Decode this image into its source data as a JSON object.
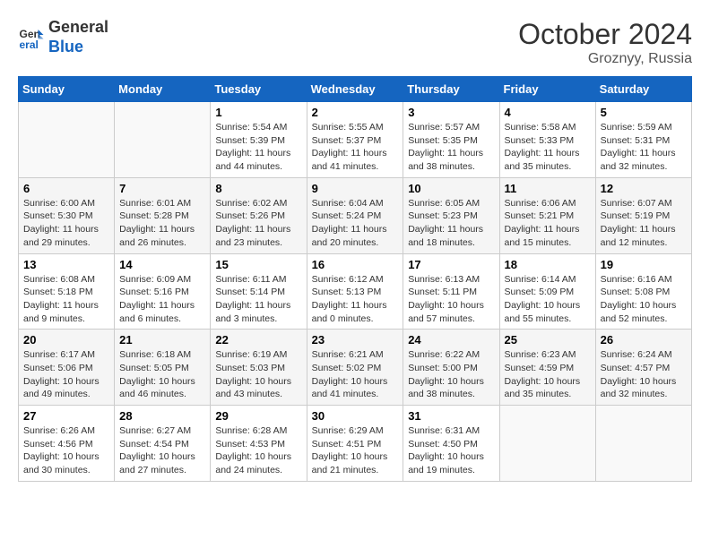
{
  "header": {
    "logo_line1": "General",
    "logo_line2": "Blue",
    "month": "October 2024",
    "location": "Groznyy, Russia"
  },
  "weekdays": [
    "Sunday",
    "Monday",
    "Tuesday",
    "Wednesday",
    "Thursday",
    "Friday",
    "Saturday"
  ],
  "weeks": [
    [
      {
        "day": "",
        "sunrise": "",
        "sunset": "",
        "daylight": ""
      },
      {
        "day": "",
        "sunrise": "",
        "sunset": "",
        "daylight": ""
      },
      {
        "day": "1",
        "sunrise": "Sunrise: 5:54 AM",
        "sunset": "Sunset: 5:39 PM",
        "daylight": "Daylight: 11 hours and 44 minutes."
      },
      {
        "day": "2",
        "sunrise": "Sunrise: 5:55 AM",
        "sunset": "Sunset: 5:37 PM",
        "daylight": "Daylight: 11 hours and 41 minutes."
      },
      {
        "day": "3",
        "sunrise": "Sunrise: 5:57 AM",
        "sunset": "Sunset: 5:35 PM",
        "daylight": "Daylight: 11 hours and 38 minutes."
      },
      {
        "day": "4",
        "sunrise": "Sunrise: 5:58 AM",
        "sunset": "Sunset: 5:33 PM",
        "daylight": "Daylight: 11 hours and 35 minutes."
      },
      {
        "day": "5",
        "sunrise": "Sunrise: 5:59 AM",
        "sunset": "Sunset: 5:31 PM",
        "daylight": "Daylight: 11 hours and 32 minutes."
      }
    ],
    [
      {
        "day": "6",
        "sunrise": "Sunrise: 6:00 AM",
        "sunset": "Sunset: 5:30 PM",
        "daylight": "Daylight: 11 hours and 29 minutes."
      },
      {
        "day": "7",
        "sunrise": "Sunrise: 6:01 AM",
        "sunset": "Sunset: 5:28 PM",
        "daylight": "Daylight: 11 hours and 26 minutes."
      },
      {
        "day": "8",
        "sunrise": "Sunrise: 6:02 AM",
        "sunset": "Sunset: 5:26 PM",
        "daylight": "Daylight: 11 hours and 23 minutes."
      },
      {
        "day": "9",
        "sunrise": "Sunrise: 6:04 AM",
        "sunset": "Sunset: 5:24 PM",
        "daylight": "Daylight: 11 hours and 20 minutes."
      },
      {
        "day": "10",
        "sunrise": "Sunrise: 6:05 AM",
        "sunset": "Sunset: 5:23 PM",
        "daylight": "Daylight: 11 hours and 18 minutes."
      },
      {
        "day": "11",
        "sunrise": "Sunrise: 6:06 AM",
        "sunset": "Sunset: 5:21 PM",
        "daylight": "Daylight: 11 hours and 15 minutes."
      },
      {
        "day": "12",
        "sunrise": "Sunrise: 6:07 AM",
        "sunset": "Sunset: 5:19 PM",
        "daylight": "Daylight: 11 hours and 12 minutes."
      }
    ],
    [
      {
        "day": "13",
        "sunrise": "Sunrise: 6:08 AM",
        "sunset": "Sunset: 5:18 PM",
        "daylight": "Daylight: 11 hours and 9 minutes."
      },
      {
        "day": "14",
        "sunrise": "Sunrise: 6:09 AM",
        "sunset": "Sunset: 5:16 PM",
        "daylight": "Daylight: 11 hours and 6 minutes."
      },
      {
        "day": "15",
        "sunrise": "Sunrise: 6:11 AM",
        "sunset": "Sunset: 5:14 PM",
        "daylight": "Daylight: 11 hours and 3 minutes."
      },
      {
        "day": "16",
        "sunrise": "Sunrise: 6:12 AM",
        "sunset": "Sunset: 5:13 PM",
        "daylight": "Daylight: 11 hours and 0 minutes."
      },
      {
        "day": "17",
        "sunrise": "Sunrise: 6:13 AM",
        "sunset": "Sunset: 5:11 PM",
        "daylight": "Daylight: 10 hours and 57 minutes."
      },
      {
        "day": "18",
        "sunrise": "Sunrise: 6:14 AM",
        "sunset": "Sunset: 5:09 PM",
        "daylight": "Daylight: 10 hours and 55 minutes."
      },
      {
        "day": "19",
        "sunrise": "Sunrise: 6:16 AM",
        "sunset": "Sunset: 5:08 PM",
        "daylight": "Daylight: 10 hours and 52 minutes."
      }
    ],
    [
      {
        "day": "20",
        "sunrise": "Sunrise: 6:17 AM",
        "sunset": "Sunset: 5:06 PM",
        "daylight": "Daylight: 10 hours and 49 minutes."
      },
      {
        "day": "21",
        "sunrise": "Sunrise: 6:18 AM",
        "sunset": "Sunset: 5:05 PM",
        "daylight": "Daylight: 10 hours and 46 minutes."
      },
      {
        "day": "22",
        "sunrise": "Sunrise: 6:19 AM",
        "sunset": "Sunset: 5:03 PM",
        "daylight": "Daylight: 10 hours and 43 minutes."
      },
      {
        "day": "23",
        "sunrise": "Sunrise: 6:21 AM",
        "sunset": "Sunset: 5:02 PM",
        "daylight": "Daylight: 10 hours and 41 minutes."
      },
      {
        "day": "24",
        "sunrise": "Sunrise: 6:22 AM",
        "sunset": "Sunset: 5:00 PM",
        "daylight": "Daylight: 10 hours and 38 minutes."
      },
      {
        "day": "25",
        "sunrise": "Sunrise: 6:23 AM",
        "sunset": "Sunset: 4:59 PM",
        "daylight": "Daylight: 10 hours and 35 minutes."
      },
      {
        "day": "26",
        "sunrise": "Sunrise: 6:24 AM",
        "sunset": "Sunset: 4:57 PM",
        "daylight": "Daylight: 10 hours and 32 minutes."
      }
    ],
    [
      {
        "day": "27",
        "sunrise": "Sunrise: 6:26 AM",
        "sunset": "Sunset: 4:56 PM",
        "daylight": "Daylight: 10 hours and 30 minutes."
      },
      {
        "day": "28",
        "sunrise": "Sunrise: 6:27 AM",
        "sunset": "Sunset: 4:54 PM",
        "daylight": "Daylight: 10 hours and 27 minutes."
      },
      {
        "day": "29",
        "sunrise": "Sunrise: 6:28 AM",
        "sunset": "Sunset: 4:53 PM",
        "daylight": "Daylight: 10 hours and 24 minutes."
      },
      {
        "day": "30",
        "sunrise": "Sunrise: 6:29 AM",
        "sunset": "Sunset: 4:51 PM",
        "daylight": "Daylight: 10 hours and 21 minutes."
      },
      {
        "day": "31",
        "sunrise": "Sunrise: 6:31 AM",
        "sunset": "Sunset: 4:50 PM",
        "daylight": "Daylight: 10 hours and 19 minutes."
      },
      {
        "day": "",
        "sunrise": "",
        "sunset": "",
        "daylight": ""
      },
      {
        "day": "",
        "sunrise": "",
        "sunset": "",
        "daylight": ""
      }
    ]
  ]
}
